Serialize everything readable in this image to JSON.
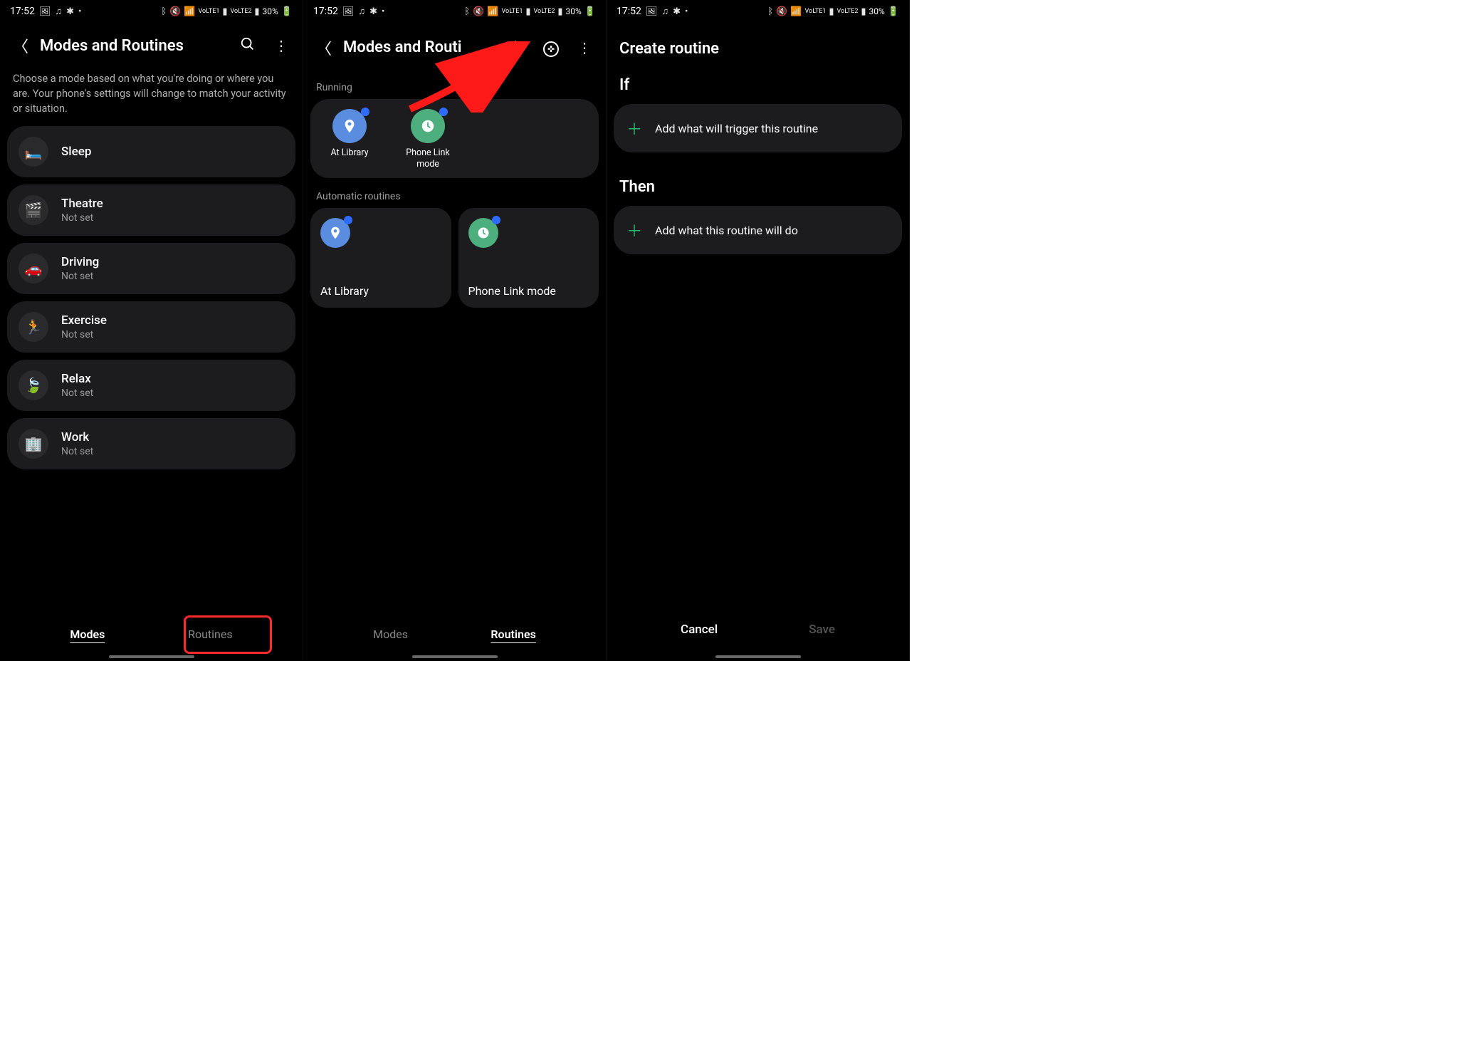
{
  "status": {
    "time": "17:52",
    "battery": "30%"
  },
  "screen1": {
    "title": "Modes and Routines",
    "description": "Choose a mode based on what you're doing or where you are. Your phone's settings will change to match your activity or situation.",
    "modes": [
      {
        "title": "Sleep",
        "sub": "",
        "emoji": "🛏️",
        "color": "#6b6cff"
      },
      {
        "title": "Theatre",
        "sub": "Not set",
        "emoji": "🎬",
        "color": "#d94a4a"
      },
      {
        "title": "Driving",
        "sub": "Not set",
        "emoji": "🚗",
        "color": "#2d8fe0"
      },
      {
        "title": "Exercise",
        "sub": "Not set",
        "emoji": "🏃",
        "color": "#2ab56a"
      },
      {
        "title": "Relax",
        "sub": "Not set",
        "emoji": "🍃",
        "color": "#9b59e0"
      },
      {
        "title": "Work",
        "sub": "Not set",
        "emoji": "🏢",
        "color": "#e0892d"
      }
    ],
    "tabs": {
      "modes": "Modes",
      "routines": "Routines"
    }
  },
  "screen2": {
    "title": "Modes and Routi",
    "sections": {
      "running": "Running",
      "auto": "Automatic routines"
    },
    "running": [
      {
        "label": "At Library",
        "bg": "blue",
        "glyph": "📍"
      },
      {
        "label": "Phone Link mode",
        "bg": "green",
        "glyph": "🕒"
      }
    ],
    "auto": [
      {
        "label": "At Library",
        "bg": "blue",
        "glyph": "📍"
      },
      {
        "label": "Phone Link mode",
        "bg": "green",
        "glyph": "🕒"
      }
    ],
    "tabs": {
      "modes": "Modes",
      "routines": "Routines"
    }
  },
  "screen3": {
    "title": "Create routine",
    "if_label": "If",
    "if_prompt": "Add what will trigger this routine",
    "then_label": "Then",
    "then_prompt": "Add what this routine will do",
    "cancel": "Cancel",
    "save": "Save"
  }
}
